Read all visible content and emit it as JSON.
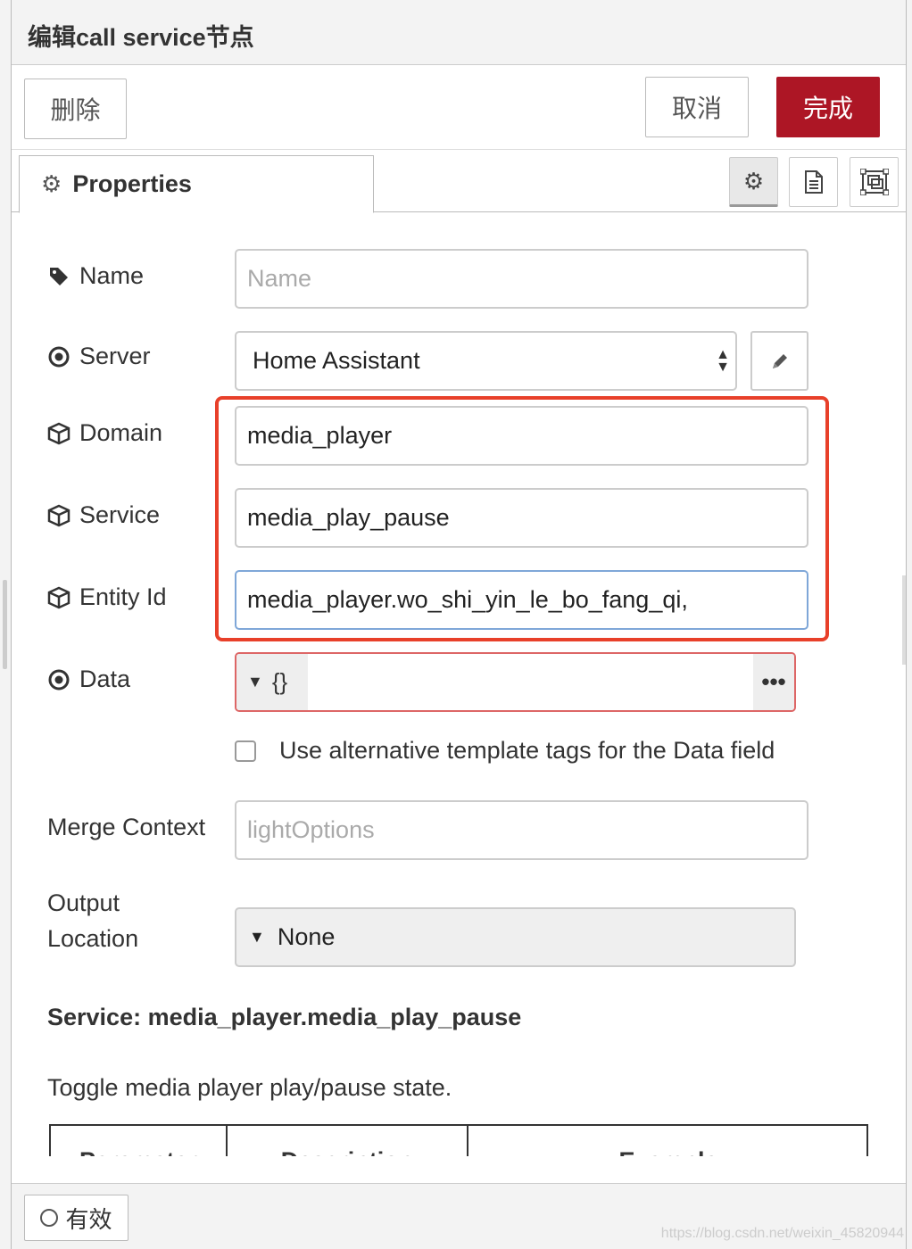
{
  "tray": {
    "title": "编辑call service节点"
  },
  "toolbar": {
    "delete_label": "删除",
    "cancel_label": "取消",
    "done_label": "完成"
  },
  "tabs": {
    "properties_label": "Properties"
  },
  "form": {
    "name": {
      "label": "Name",
      "placeholder": "Name"
    },
    "server": {
      "label": "Server",
      "value": "Home Assistant"
    },
    "domain": {
      "label": "Domain",
      "value": "media_player"
    },
    "service": {
      "label": "Service",
      "value": "media_play_pause"
    },
    "entity": {
      "label": "Entity Id",
      "value": "media_player.wo_shi_yin_le_bo_fang_qi,"
    },
    "data": {
      "label": "Data",
      "type": "{}",
      "more": "•••"
    },
    "alt_tags": {
      "label": "Use alternative template tags for the Data field",
      "checked": false
    },
    "merge": {
      "label": "Merge Context",
      "placeholder": "lightOptions"
    },
    "output": {
      "label_line1": "Output",
      "label_line2": "Location",
      "value": "None"
    }
  },
  "service_info": {
    "title": "Service: media_player.media_play_pause",
    "description": "Toggle media player play/pause state.",
    "table_headers": [
      "Parameter",
      "Description",
      "Example"
    ]
  },
  "footer": {
    "enable_label": "有效",
    "watermark": "https://blog.csdn.net/weixin_45820944"
  },
  "colors": {
    "primary": "#ad1625",
    "highlight": "#e8402a",
    "error_border": "#dd6666",
    "focus_border": "#7fa7d8"
  }
}
